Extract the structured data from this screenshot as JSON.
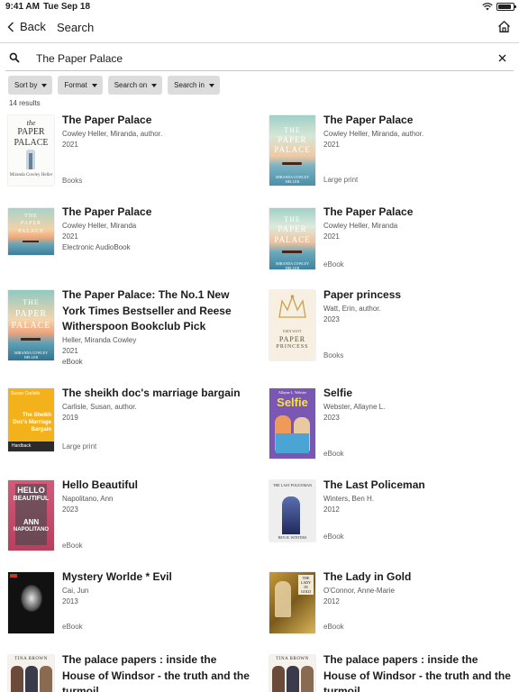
{
  "status_bar": {
    "time": "9:41 AM",
    "date": "Tue Sep 18"
  },
  "nav": {
    "back_label": "Back",
    "title": "Search"
  },
  "search": {
    "value": "The Paper Palace",
    "placeholder": "Search"
  },
  "filters": [
    {
      "label": "Sort by"
    },
    {
      "label": "Format"
    },
    {
      "label": "Search on"
    },
    {
      "label": "Search in"
    }
  ],
  "results_count": "14 results",
  "results": [
    {
      "title": "The Paper Palace",
      "author": "Cowley Heller, Miranda, author.",
      "year": "2021",
      "format": "Books",
      "cover": "paper-palace-white"
    },
    {
      "title": "The Paper Palace",
      "author": "Cowley Heller, Miranda, author.",
      "year": "2021",
      "format": "Large print",
      "cover": "paper-palace-sunset"
    },
    {
      "title": "The Paper Palace",
      "author": "Cowley Heller, Miranda",
      "year": "2021",
      "format": "Electronic AudioBook",
      "cover": "paper-palace-sunset"
    },
    {
      "title": "The Paper Palace",
      "author": "Cowley Heller, Miranda",
      "year": "2021",
      "format": "eBook",
      "cover": "paper-palace-sunset"
    },
    {
      "title": "The Paper Palace: The No.1 New York Times Bestseller and Reese Witherspoon Bookclub Pick",
      "author": "Heller, Miranda Cowley",
      "year": "2021",
      "format": "eBook",
      "cover": "paper-palace-sunset"
    },
    {
      "title": "Paper princess",
      "author": "Watt, Erin, author.",
      "year": "2023",
      "format": "Books",
      "cover": "paper-princess"
    },
    {
      "title": "The sheikh doc's marriage bargain",
      "author": "Carlisle, Susan, author.",
      "year": "2019",
      "format": "Large print",
      "cover": "sheikh-doc"
    },
    {
      "title": "Selfie",
      "author": "Webster, Allayne L.",
      "year": "2023",
      "format": "eBook",
      "cover": "selfie"
    },
    {
      "title": "Hello Beautiful",
      "author": "Napolitano, Ann",
      "year": "2023",
      "format": "eBook",
      "cover": "hello-beautiful"
    },
    {
      "title": "The Last Policeman",
      "author": "Winters, Ben H.",
      "year": "2012",
      "format": "eBook",
      "cover": "last-policeman"
    },
    {
      "title": "Mystery Worlde * Evil",
      "author": "Cai, Jun",
      "year": "2013",
      "format": "eBook",
      "cover": "mystery-worlde"
    },
    {
      "title": "The Lady in Gold",
      "author": "O'Connor, Anne-Marie",
      "year": "2012",
      "format": "eBook",
      "cover": "lady-in-gold"
    },
    {
      "title": "The palace papers : inside the House of Windsor - the truth and the turmoil",
      "author": "",
      "year": "",
      "format": "",
      "cover": "palace-papers"
    },
    {
      "title": "The palace papers : inside the House of Windsor - the truth and the turmoil",
      "author": "",
      "year": "",
      "format": "",
      "cover": "palace-papers"
    }
  ],
  "cover_text": {
    "paper_palace_white": {
      "top": "the",
      "line1": "PAPER",
      "line2": "PALACE",
      "author": "Miranda Cowley Heller"
    },
    "paper_palace_sunset": {
      "line1": "THE",
      "line2": "PAPER",
      "line3": "PALACE",
      "author": "MIRANDA COWLEY HELLER"
    },
    "paper_princess": {
      "line1": "ERIN WATT",
      "line2": "PAPER",
      "line3": "PRINCESS"
    },
    "sheikh_doc": {
      "author": "Susan Carlisle",
      "title": "The Sheikh Doc's Marriage Bargain",
      "badge": "Hardback"
    },
    "selfie": {
      "title": "Selfie",
      "author": "Allayne L. Webster"
    },
    "hello_beautiful": {
      "line1": "HELLO",
      "line2": "BEAUTIFUL",
      "line3": "ANN",
      "line4": "NAPOLITANO"
    },
    "last_policeman": {
      "title": "THE LAST POLICEMAN",
      "author": "BEN H. WINTERS"
    },
    "lady_in_gold": {
      "title": "THE LADY IN GOLD"
    },
    "palace_papers": {
      "author": "TINA BROWN"
    }
  },
  "colors": {
    "accent": "#1c1c1c",
    "filter_bg": "#dcdcdc",
    "divider": "#d6d6d6"
  }
}
